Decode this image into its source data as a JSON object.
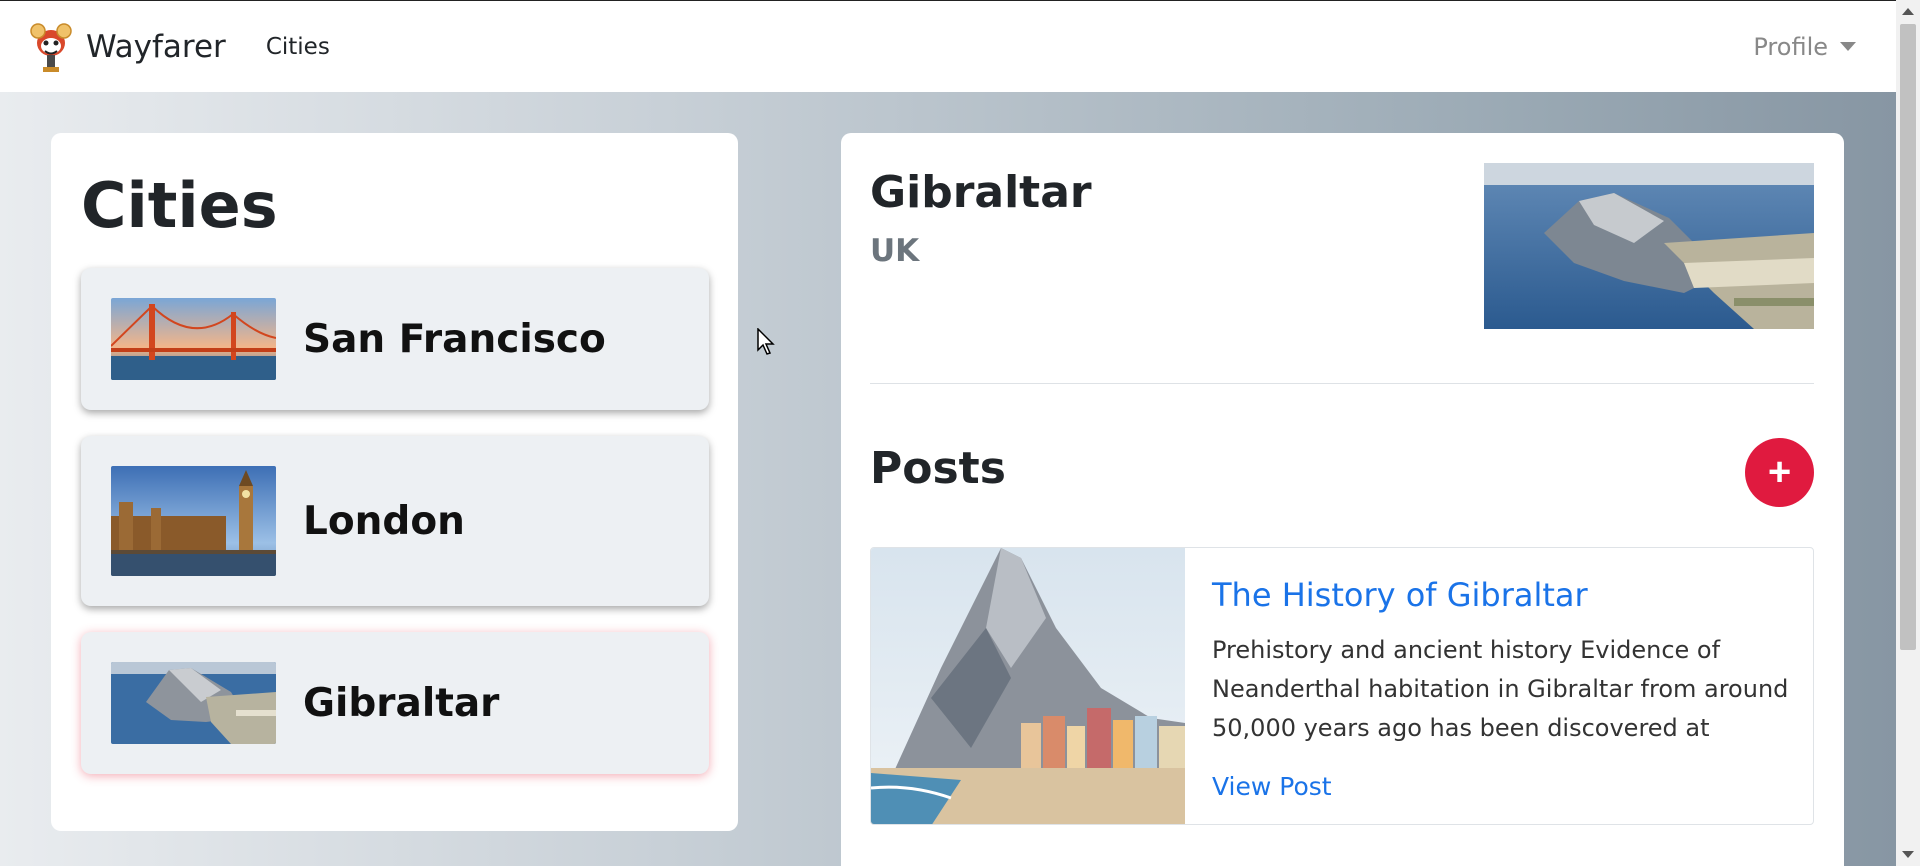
{
  "navbar": {
    "brand": "Wayfarer",
    "cities_link": "Cities",
    "profile_label": "Profile"
  },
  "sidebar": {
    "title": "Cities",
    "items": [
      {
        "name": "San Francisco",
        "active": false
      },
      {
        "name": "London",
        "active": false
      },
      {
        "name": "Gibraltar",
        "active": true
      }
    ]
  },
  "detail": {
    "city": "Gibraltar",
    "country": "UK",
    "posts_heading": "Posts",
    "add_button": "+",
    "post": {
      "title": "The History of Gibraltar",
      "excerpt": "Prehistory and ancient history Evidence of Neanderthal habitation in Gibraltar from around 50,000 years ago has been discovered at",
      "link": "View Post"
    }
  },
  "colors": {
    "accent": "#e01a3f",
    "link": "#1a73e8",
    "active_glow": "#e6465a"
  }
}
